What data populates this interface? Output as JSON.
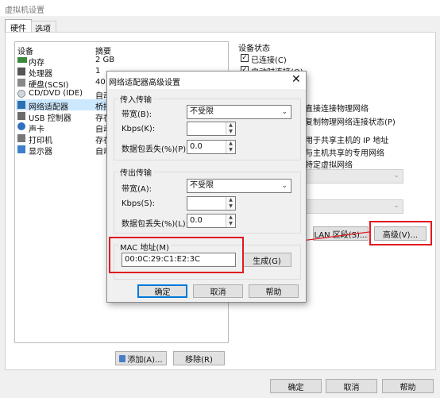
{
  "window": {
    "title": "虚拟机设置"
  },
  "tabs": [
    {
      "label": "硬件"
    },
    {
      "label": "选项"
    }
  ],
  "device_list": {
    "headers": {
      "device": "设备",
      "summary": "摘要"
    },
    "rows": [
      {
        "device": "内存",
        "summary": "2 GB"
      },
      {
        "device": "处理器",
        "summary": "1"
      },
      {
        "device": "硬盘(SCSI)",
        "summary": "40"
      },
      {
        "device": "CD/DVD (IDE)",
        "summary": "自动"
      },
      {
        "device": "网络适配器",
        "summary": "桥接"
      },
      {
        "device": "USB 控制器",
        "summary": "存在"
      },
      {
        "device": "声卡",
        "summary": "自动"
      },
      {
        "device": "打印机",
        "summary": "存在"
      },
      {
        "device": "显示器",
        "summary": "自动"
      }
    ]
  },
  "device_status": {
    "title": "设备状态",
    "connected": "已连接(C)",
    "connect_on_start": "启动时连接(O)"
  },
  "network_conn_partial": {
    "bridged_replicate": "复制物理网络连接状态(P)",
    "direct_connect": "直接连接物理网络",
    "nat_text": "用于共享主机的 IP 地址",
    "hostonly_text": "与主机共享的专用网络",
    "custom_text": "特定虚拟网络"
  },
  "right_buttons": {
    "lan_segment": "LAN 区段(S)...",
    "advanced": "高级(V)..."
  },
  "bottom_left_buttons": {
    "add": "添加(A)...",
    "remove": "移除(R)"
  },
  "footer_buttons": {
    "ok": "确定",
    "cancel": "取消",
    "help": "帮助"
  },
  "dialog": {
    "title": "网络适配器高级设置",
    "incoming": {
      "title": "传入传输",
      "bandwidth_label": "带宽(B):",
      "bandwidth_value": "不受限",
      "kbps_label": "Kbps(K):",
      "kbps_value": "",
      "loss_label": "数据包丢失(%)(P):",
      "loss_value": "0.0"
    },
    "outgoing": {
      "title": "传出传输",
      "bandwidth_label": "带宽(A):",
      "bandwidth_value": "不受限",
      "kbps_label": "Kbps(S):",
      "kbps_value": "",
      "loss_label": "数据包丢失(%)(L):",
      "loss_value": "0.0"
    },
    "mac": {
      "label": "MAC 地址(M)",
      "value": "00:0C:29:C1:E2:3C",
      "generate": "生成(G)"
    },
    "buttons": {
      "ok": "确定",
      "cancel": "取消",
      "help": "帮助"
    }
  },
  "colors": {
    "highlight_red": "#e0191e",
    "focus_blue": "#0078d7"
  }
}
